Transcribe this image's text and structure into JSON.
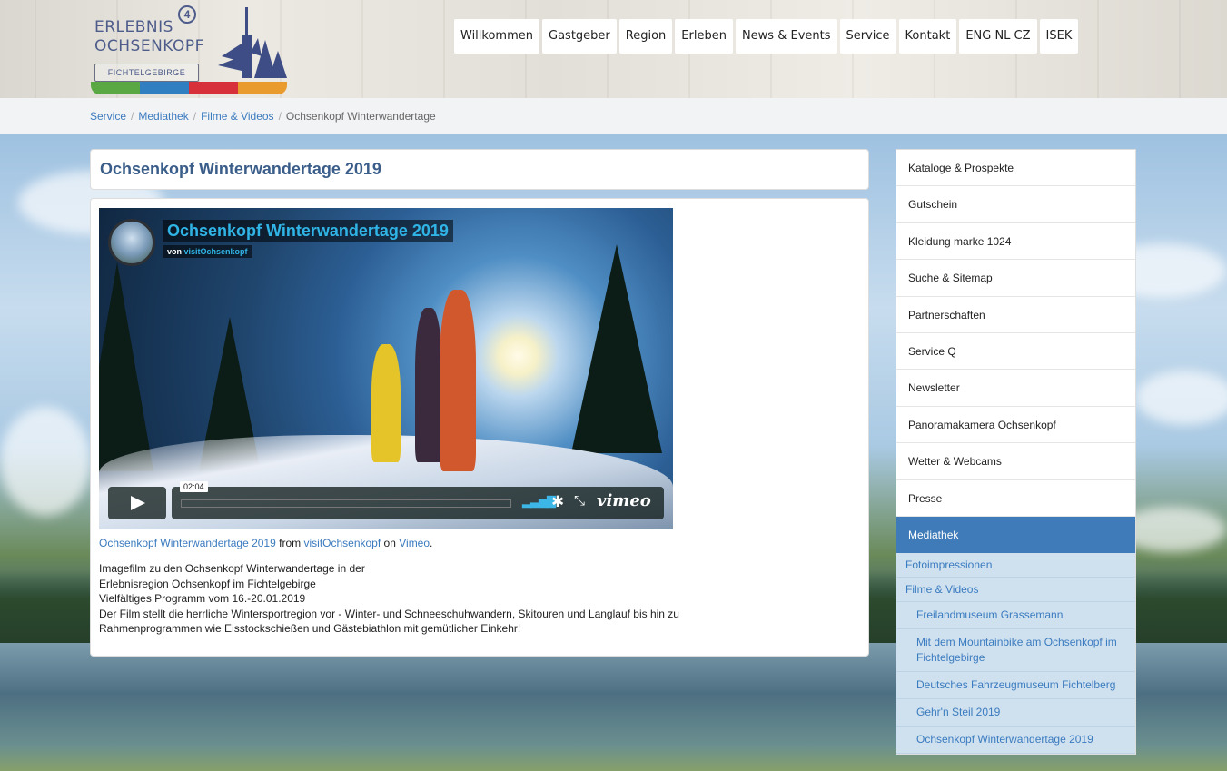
{
  "logo": {
    "line1": "ERLEBNIS",
    "line2": "OCHSENKOPF",
    "badge": "4",
    "sub": "FICHTELGEBIRGE",
    "stripe_colors": [
      "#5aa844",
      "#2f7fc1",
      "#d7303a",
      "#e99b2e"
    ]
  },
  "nav": [
    "Willkommen",
    "Gastgeber",
    "Region",
    "Erleben",
    "News & Events",
    "Service",
    "Kontakt",
    "ENG NL CZ",
    "ISEK"
  ],
  "breadcrumb": {
    "items": [
      "Service",
      "Mediathek",
      "Filme & Videos"
    ],
    "separator": "/",
    "current": "Ochsenkopf Winterwandertage"
  },
  "page": {
    "title": "Ochsenkopf Winterwandertage 2019"
  },
  "video": {
    "title": "Ochsenkopf Winterwandertage 2019",
    "by_prefix": "von",
    "by_author": "visitOchsenkopf",
    "time": "02:04",
    "brand": "vimeo",
    "icons": [
      "play-icon",
      "volume-icon",
      "gear-icon",
      "fullscreen-icon"
    ]
  },
  "caption": {
    "video_link": "Ochsenkopf Winterwandertage 2019",
    "from": "from",
    "author_link": "visitOchsenkopf",
    "on": "on",
    "platform_link": "Vimeo",
    "end": "."
  },
  "description": [
    "Imagefilm zu den Ochsenkopf Winterwandertage in der",
    "Erlebnisregion Ochsenkopf im Fichtelgebirge",
    "Vielfältiges Programm vom 16.-20.01.2019",
    "Der Film stellt die herrliche Wintersportregion vor - Winter- und Schneeschuhwandern, Skitouren und Langlauf bis hin zu",
    "Rahmenprogrammen wie Eisstockschießen und Gästebiathlon mit gemütlicher Einkehr!"
  ],
  "sidebar": {
    "items": [
      "Kataloge & Prospekte",
      "Gutschein",
      "Kleidung marke 1024",
      "Suche & Sitemap",
      "Partnerschaften",
      "Service Q",
      "Newsletter",
      "Panoramakamera Ochsenkopf",
      "Wetter & Webcams",
      "Presse"
    ],
    "active": "Mediathek",
    "sub1": [
      "Fotoimpressionen",
      "Filme & Videos"
    ],
    "sub2": [
      "Freilandmuseum Grassemann",
      "Mit dem Mountainbike am Ochsenkopf im Fichtelgebirge",
      "Deutsches Fahrzeugmuseum Fichtelberg",
      "Gehr'n Steil 2019",
      "Ochsenkopf Winterwandertage 2019"
    ]
  },
  "colors": {
    "link": "#3b7bbf",
    "title": "#3a5d89",
    "active": "#3f7bb8",
    "sub_bg": "#cfe1ef",
    "video_accent": "#30b4e6"
  }
}
